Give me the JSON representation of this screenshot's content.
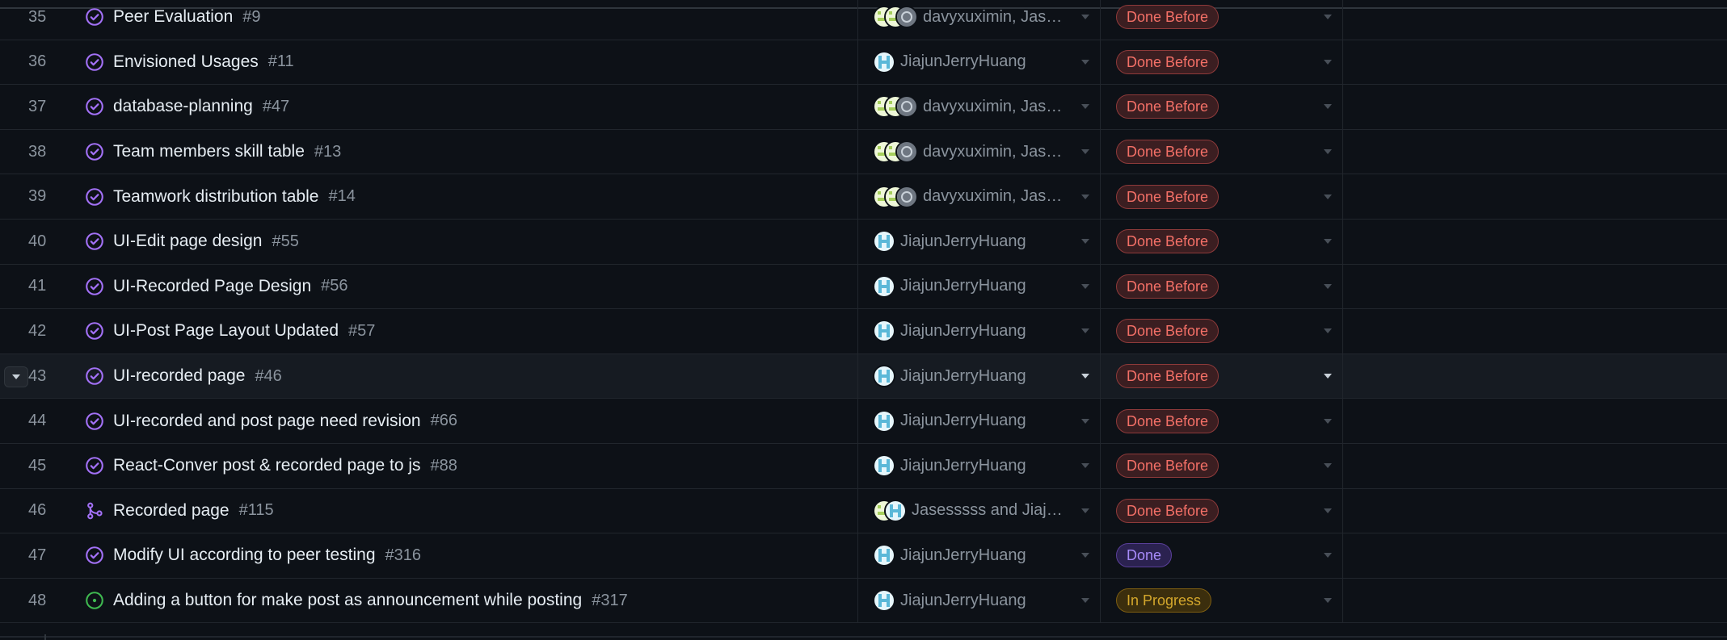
{
  "status_colors": {
    "Done Before": {
      "text": "#f47067",
      "border": "#8e3a3a",
      "bg": "#3b1e21"
    },
    "Done": {
      "text": "#a78bfa",
      "border": "#5a3f9a",
      "bg": "#2b2250"
    },
    "In Progress": {
      "text": "#d4a72c",
      "border": "#7d5d12",
      "bg": "#3b2e0d"
    }
  },
  "rows": [
    {
      "num": "35",
      "title": "Peer Evaluation",
      "issue": "#9",
      "icon": "closed-issue-icon",
      "avatars": [
        "green",
        "green",
        "gray"
      ],
      "assignees": "davyxuximin, Jases...",
      "status": "Done Before"
    },
    {
      "num": "36",
      "title": "Envisioned Usages",
      "issue": "#11",
      "icon": "closed-issue-icon",
      "avatars": [
        "blue"
      ],
      "assignees": "JiajunJerryHuang",
      "status": "Done Before"
    },
    {
      "num": "37",
      "title": "database-planning",
      "issue": "#47",
      "icon": "closed-issue-icon",
      "avatars": [
        "green",
        "green",
        "gray"
      ],
      "assignees": "davyxuximin, Jases...",
      "status": "Done Before"
    },
    {
      "num": "38",
      "title": "Team members skill table",
      "issue": "#13",
      "icon": "closed-issue-icon",
      "avatars": [
        "green",
        "green",
        "gray"
      ],
      "assignees": "davyxuximin, Jases...",
      "status": "Done Before"
    },
    {
      "num": "39",
      "title": "Teamwork distribution table",
      "issue": "#14",
      "icon": "closed-issue-icon",
      "avatars": [
        "green",
        "green",
        "gray"
      ],
      "assignees": "davyxuximin, Jases...",
      "status": "Done Before"
    },
    {
      "num": "40",
      "title": "UI-Edit page design",
      "issue": "#55",
      "icon": "closed-issue-icon",
      "avatars": [
        "blue"
      ],
      "assignees": "JiajunJerryHuang",
      "status": "Done Before"
    },
    {
      "num": "41",
      "title": "UI-Recorded Page Design",
      "issue": "#56",
      "icon": "closed-issue-icon",
      "avatars": [
        "blue"
      ],
      "assignees": "JiajunJerryHuang",
      "status": "Done Before"
    },
    {
      "num": "42",
      "title": "UI-Post Page Layout Updated",
      "issue": "#57",
      "icon": "closed-issue-icon",
      "avatars": [
        "blue"
      ],
      "assignees": "JiajunJerryHuang",
      "status": "Done Before"
    },
    {
      "num": "43",
      "title": "UI-recorded page",
      "issue": "#46",
      "icon": "closed-issue-icon",
      "avatars": [
        "blue"
      ],
      "assignees": "JiajunJerryHuang",
      "status": "Done Before",
      "hovered": true
    },
    {
      "num": "44",
      "title": "UI-recorded and post page need revision",
      "issue": "#66",
      "icon": "closed-issue-icon",
      "avatars": [
        "blue"
      ],
      "assignees": "JiajunJerryHuang",
      "status": "Done Before"
    },
    {
      "num": "45",
      "title": "React-Conver post & recorded page to js",
      "issue": "#88",
      "icon": "closed-issue-icon",
      "avatars": [
        "blue"
      ],
      "assignees": "JiajunJerryHuang",
      "status": "Done Before"
    },
    {
      "num": "46",
      "title": "Recorded page",
      "issue": "#115",
      "icon": "merged-pr-icon",
      "avatars": [
        "green",
        "blue"
      ],
      "assignees": "Jasesssss and Jiajun...",
      "status": "Done Before"
    },
    {
      "num": "47",
      "title": "Modify UI according to peer testing",
      "issue": "#316",
      "icon": "closed-issue-icon",
      "avatars": [
        "blue"
      ],
      "assignees": "JiajunJerryHuang",
      "status": "Done"
    },
    {
      "num": "48",
      "title": "Adding a button for make post as announcement while posting",
      "issue": "#317",
      "icon": "open-issue-icon",
      "avatars": [
        "blue"
      ],
      "assignees": "JiajunJerryHuang",
      "status": "In Progress"
    }
  ]
}
